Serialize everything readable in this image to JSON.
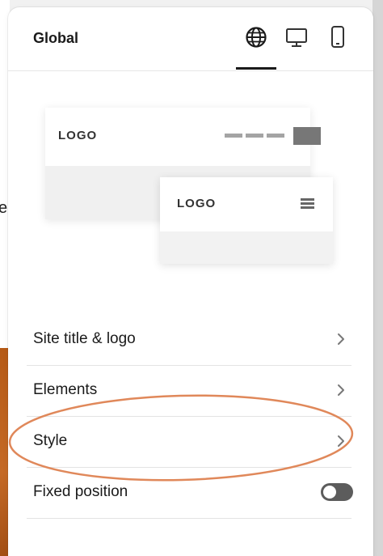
{
  "header": {
    "title": "Global",
    "view_icons": [
      "globe-icon",
      "desktop-icon",
      "mobile-icon"
    ],
    "active_view": "globe-icon"
  },
  "preview": {
    "desktop_logo": "LOGO",
    "mobile_logo": "LOGO"
  },
  "menu": {
    "items": [
      {
        "label": "Site title & logo",
        "icon": "chevron-right-icon"
      },
      {
        "label": "Elements",
        "icon": "chevron-right-icon"
      },
      {
        "label": "Style",
        "icon": "chevron-right-icon"
      },
      {
        "label": "Fixed position",
        "control": "toggle",
        "value": false
      }
    ]
  },
  "background": {
    "partial_letter": "e"
  },
  "colors": {
    "annotation": "#e0885a",
    "accent_dark": "#1a1a1a",
    "background_orange": "#b65a16"
  }
}
